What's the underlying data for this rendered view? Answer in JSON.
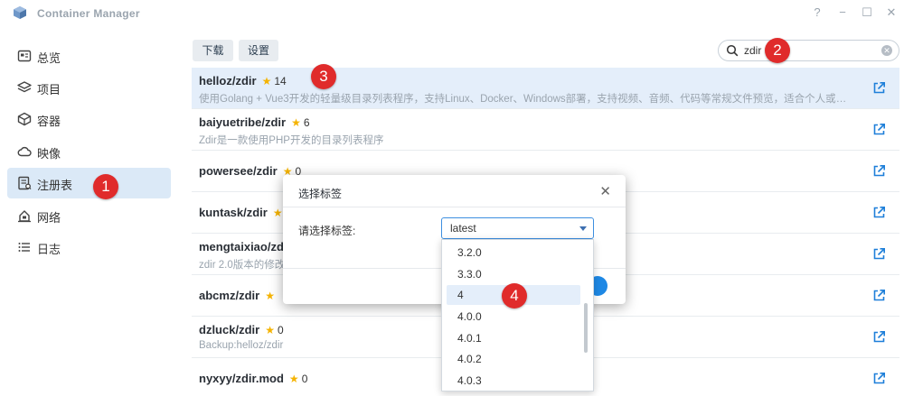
{
  "app": {
    "title": "Container Manager"
  },
  "window_controls": {
    "help": "?",
    "minimize": "−",
    "maximize": "☐",
    "close": "✕"
  },
  "sidebar": {
    "items": [
      {
        "label": "总览",
        "icon": "overview-icon"
      },
      {
        "label": "项目",
        "icon": "layers-icon"
      },
      {
        "label": "容器",
        "icon": "cube-icon"
      },
      {
        "label": "映像",
        "icon": "cloud-icon"
      },
      {
        "label": "注册表",
        "icon": "registry-icon",
        "active": true
      },
      {
        "label": "网络",
        "icon": "network-icon"
      },
      {
        "label": "日志",
        "icon": "log-list-icon"
      }
    ]
  },
  "toolbar": {
    "download_label": "下载",
    "settings_label": "设置"
  },
  "search": {
    "value": "zdir",
    "placeholder": ""
  },
  "results": [
    {
      "name": "helloz/zdir",
      "stars": "14",
      "desc": "使用Golang + Vue3开发的轻量级目录列表程序，支持Linux、Docker、Windows部署，支持视频、音频、代码等常规文件预览，适合个人或初创...",
      "selected": true
    },
    {
      "name": "baiyuetribe/zdir",
      "stars": "6",
      "desc": "Zdir是一款使用PHP开发的目录列表程序"
    },
    {
      "name": "powersee/zdir",
      "stars": "0",
      "desc": ""
    },
    {
      "name": "kuntask/zdir",
      "stars": "",
      "desc": ""
    },
    {
      "name": "mengtaixiao/zd",
      "stars": "",
      "desc": "zdir 2.0版本的修改"
    },
    {
      "name": "abcmz/zdir",
      "stars": "",
      "desc": ""
    },
    {
      "name": "dzluck/zdir",
      "stars": "0",
      "desc": "Backup:helloz/zdir"
    },
    {
      "name": "nyxyy/zdir.mod",
      "stars": "0",
      "desc": ""
    }
  ],
  "dialog": {
    "title": "选择标签",
    "close": "✕",
    "tag_label": "请选择标签:",
    "selected_tag": "latest",
    "options": [
      "3.2.0",
      "3.3.0",
      "4",
      "4.0.0",
      "4.0.1",
      "4.0.2",
      "4.0.3"
    ],
    "hover_option": "4"
  },
  "annotations": [
    "1",
    "2",
    "3",
    "4"
  ],
  "colors": {
    "accent": "#1e88e5",
    "selected_row": "#e4eefa",
    "active_nav": "#dbe9f7",
    "badge": "#e02b2b",
    "star": "#f5b301"
  }
}
